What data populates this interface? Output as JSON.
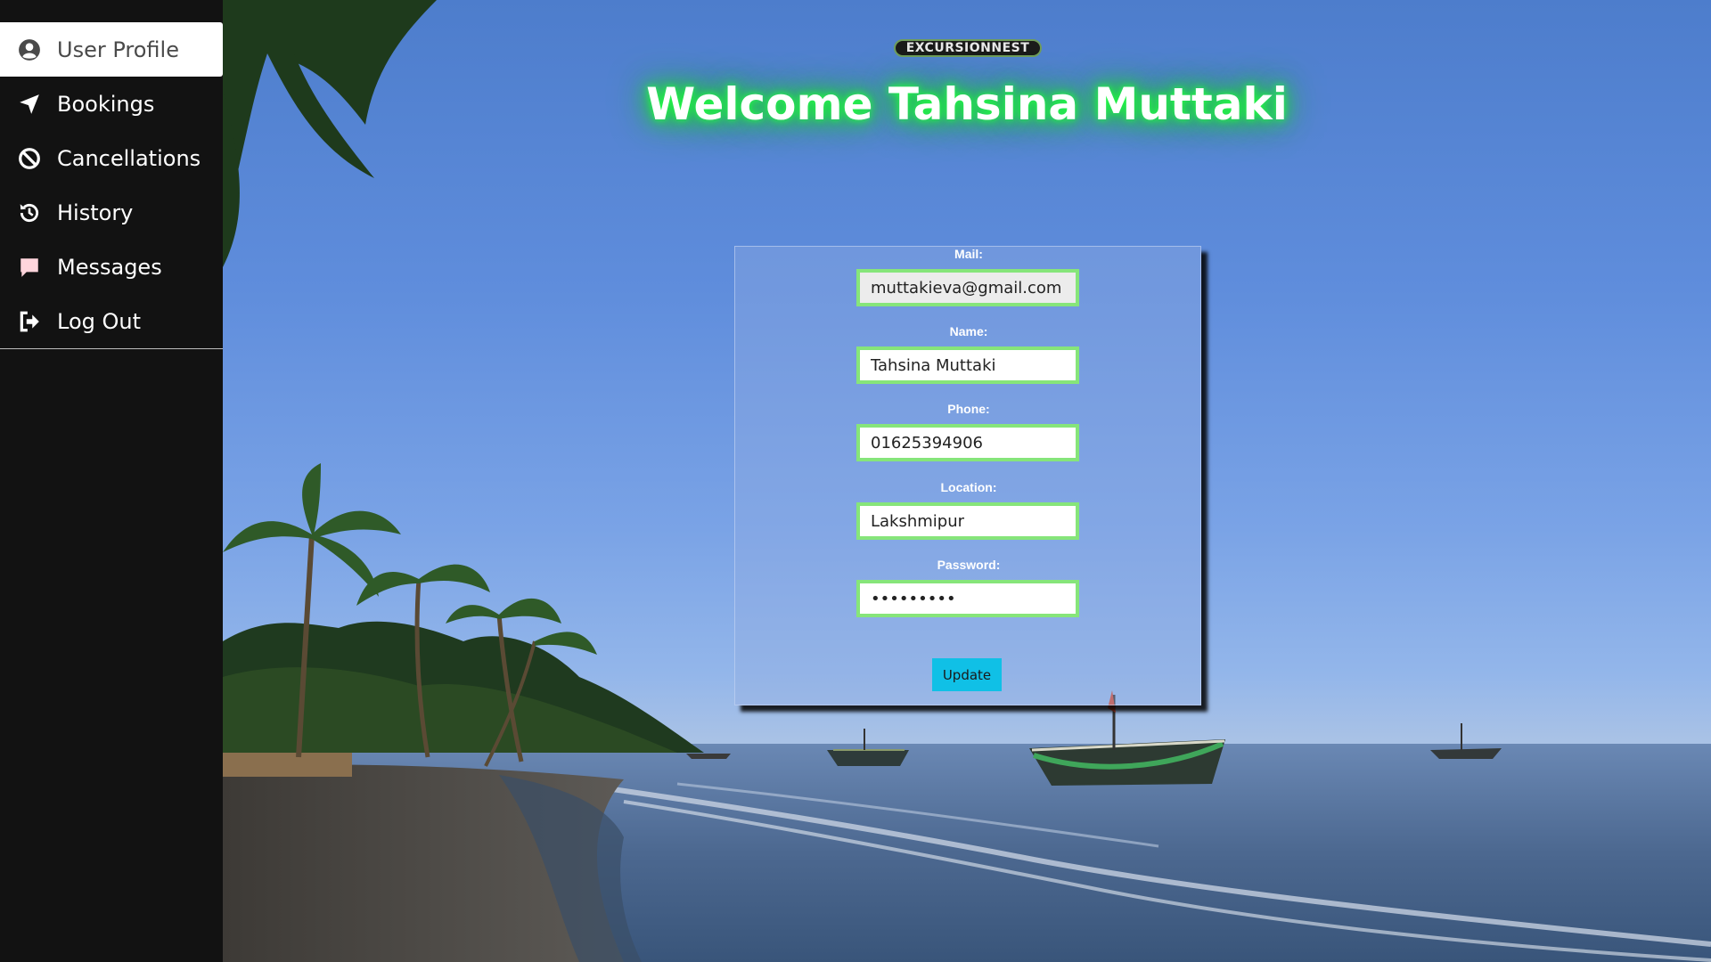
{
  "sidebar": {
    "items": [
      {
        "label": "User Profile",
        "icon": "user-circle-icon",
        "active": true
      },
      {
        "label": "Bookings",
        "icon": "paper-plane-icon",
        "active": false
      },
      {
        "label": "Cancellations",
        "icon": "ban-icon",
        "active": false
      },
      {
        "label": "History",
        "icon": "history-icon",
        "active": false
      },
      {
        "label": "Messages",
        "icon": "message-icon",
        "active": false
      },
      {
        "label": "Log Out",
        "icon": "logout-icon",
        "active": false
      }
    ]
  },
  "header": {
    "logo_text": "EXCURSIONNEST",
    "welcome": "Welcome Tahsina Muttaki"
  },
  "form": {
    "mail_label": "Mail:",
    "mail_value": "muttakieva@gmail.com",
    "name_label": "Name:",
    "name_value": "Tahsina Muttaki",
    "phone_label": "Phone:",
    "phone_value": "01625394906",
    "location_label": "Location:",
    "location_value": "Lakshmipur",
    "password_label": "Password:",
    "password_value": "•••••••••",
    "update_label": "Update"
  },
  "colors": {
    "sidebar_bg": "#121212",
    "input_border": "#86e57a",
    "update_button": "#10c0e6",
    "welcome_glow": "#22ff44"
  }
}
